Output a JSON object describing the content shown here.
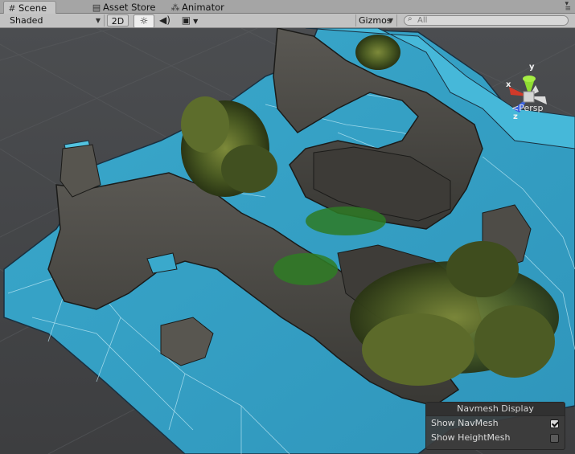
{
  "tabs": [
    {
      "label": "Scene",
      "icon": "grid-icon",
      "active": true
    },
    {
      "label": "Asset Store",
      "icon": "store-icon",
      "active": false
    },
    {
      "label": "Animator",
      "icon": "animator-icon",
      "active": false
    }
  ],
  "toolbar": {
    "shading_mode": "Shaded",
    "mode_2d_label": "2D",
    "gizmos_label": "Gizmos",
    "search_placeholder": "All"
  },
  "gizmo": {
    "x_label": "x",
    "y_label": "y",
    "z_label": "z",
    "projection": "Persp",
    "colors": {
      "x": "#d23a2a",
      "y": "#8fdc32",
      "z": "#3a62e0"
    }
  },
  "navmesh_panel": {
    "title": "Navmesh Display",
    "options": [
      {
        "label": "Show NavMesh",
        "checked": true
      },
      {
        "label": "Show HeightMesh",
        "checked": false
      }
    ]
  },
  "colors": {
    "navmesh": "#3fb0d2",
    "terrain": "#4f4d48",
    "grid_background": "#444648"
  }
}
